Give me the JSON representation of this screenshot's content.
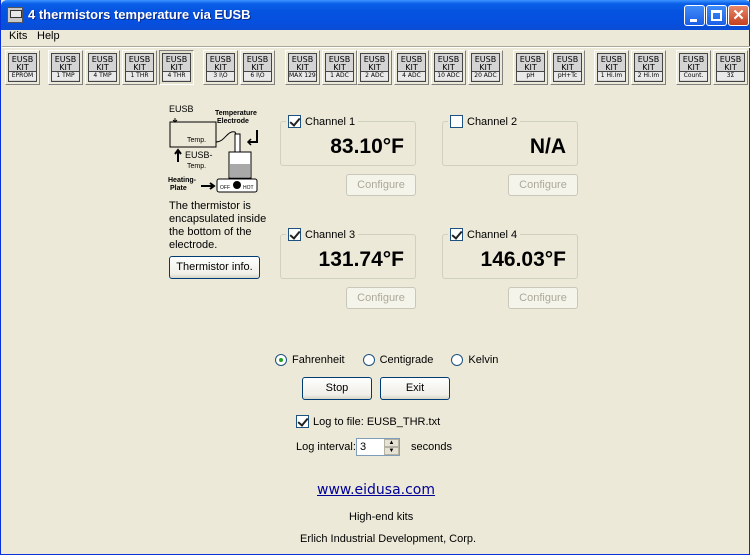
{
  "window": {
    "title": "4 thermistors temperature via EUSB"
  },
  "menu": [
    {
      "label": "Kits"
    },
    {
      "label": "Help"
    }
  ],
  "toolbar": [
    {
      "l1": "EUSB",
      "l2": "KIT",
      "l3": "EPROM",
      "pressed": false
    },
    {
      "l1": "EUSB",
      "l2": "KIT",
      "l3": "1 TMP",
      "pressed": false
    },
    {
      "l1": "EUSB",
      "l2": "KIT",
      "l3": "4 TMP",
      "pressed": false
    },
    {
      "l1": "EUSB",
      "l2": "KIT",
      "l3": "1 THR",
      "pressed": false
    },
    {
      "l1": "EUSB",
      "l2": "KIT",
      "l3": "4 THR",
      "pressed": true
    },
    {
      "l1": "EUSB",
      "l2": "KIT",
      "l3": "3 I\\O",
      "pressed": false
    },
    {
      "l1": "EUSB",
      "l2": "KIT",
      "l3": "6 I\\O",
      "pressed": false
    },
    {
      "l1": "EUSB",
      "l2": "KIT",
      "l3": "MAX 1296",
      "pressed": false
    },
    {
      "l1": "EUSB",
      "l2": "KIT",
      "l3": "1 ADC",
      "pressed": false
    },
    {
      "l1": "EUSB",
      "l2": "KIT",
      "l3": "2 ADC",
      "pressed": false
    },
    {
      "l1": "EUSB",
      "l2": "KIT",
      "l3": "4 ADC",
      "pressed": false
    },
    {
      "l1": "EUSB",
      "l2": "KIT",
      "l3": "10 ADC",
      "pressed": false
    },
    {
      "l1": "EUSB",
      "l2": "KIT",
      "l3": "20 ADC",
      "pressed": false
    },
    {
      "l1": "EUSB",
      "l2": "KIT",
      "l3": "pH",
      "pressed": false
    },
    {
      "l1": "EUSB",
      "l2": "KIT",
      "l3": "pH+Tc",
      "pressed": false
    },
    {
      "l1": "EUSB",
      "l2": "KIT",
      "l3": "1 Hi.Im",
      "pressed": false
    },
    {
      "l1": "EUSB",
      "l2": "KIT",
      "l3": "2 Hi.Im",
      "pressed": false
    },
    {
      "l1": "EUSB",
      "l2": "KIT",
      "l3": "Count.",
      "pressed": false
    },
    {
      "l1": "EUSB",
      "l2": "KIT",
      "l3": "3Σ",
      "pressed": false
    }
  ],
  "diagram": {
    "label_eusb": "EUSB",
    "label_temperature": "Temperature",
    "label_electrode": "Electrode",
    "label_temp": "Temp.",
    "label_eusb_temp_1": "EUSB-",
    "label_eusb_temp_2": "Temp.",
    "label_heating_1": "Heating-",
    "label_heating_2": "Plate",
    "label_off": "OFF",
    "label_hot": "HOT",
    "description": "The thermistor is encapsulated inside the bottom of the electrode."
  },
  "thermistor_info_label": "Thermistor info.",
  "channels": [
    {
      "label": "Channel 1",
      "checked": true,
      "reading": "83.10°F",
      "configure_label": "Configure"
    },
    {
      "label": "Channel 2",
      "checked": false,
      "reading": "N/A",
      "configure_label": "Configure"
    },
    {
      "label": "Channel 3",
      "checked": true,
      "reading": "131.74°F",
      "configure_label": "Configure"
    },
    {
      "label": "Channel 4",
      "checked": true,
      "reading": "146.03°F",
      "configure_label": "Configure"
    }
  ],
  "units": {
    "options": [
      "Fahrenheit",
      "Centigrade",
      "Kelvin"
    ],
    "selected": "Fahrenheit"
  },
  "actions": {
    "stop_label": "Stop",
    "exit_label": "Exit"
  },
  "log": {
    "checked": true,
    "file_label": "Log to file: EUSB_THR.txt",
    "interval_label": "Log interval:",
    "interval_value": "3",
    "interval_unit": "seconds"
  },
  "footer": {
    "link": "www.eidusa.com",
    "tagline": "High-end kits",
    "company": "Erlich Industrial Development, Corp."
  }
}
